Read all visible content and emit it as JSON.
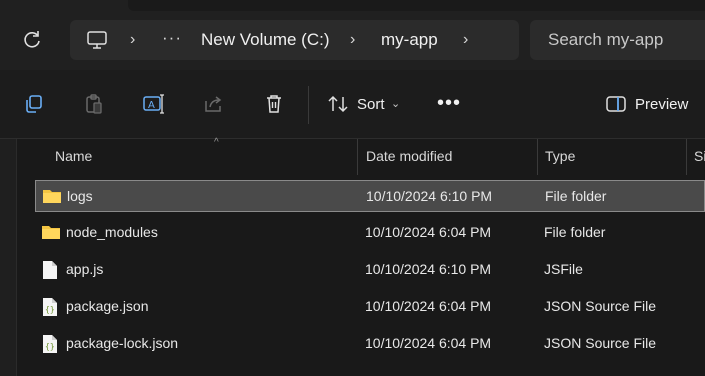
{
  "breadcrumbs": [
    "New Volume (C:)",
    "my-app"
  ],
  "search": {
    "placeholder": "Search my-app"
  },
  "toolbar": {
    "sort_label": "Sort",
    "preview_label": "Preview"
  },
  "columns": [
    "Name",
    "Date modified",
    "Type",
    "Si"
  ],
  "files": [
    {
      "name": "logs",
      "date": "10/10/2024 6:10 PM",
      "type": "File folder",
      "icon": "folder-icon"
    },
    {
      "name": "node_modules",
      "date": "10/10/2024 6:04 PM",
      "type": "File folder",
      "icon": "folder-icon"
    },
    {
      "name": "app.js",
      "date": "10/10/2024 6:10 PM",
      "type": "JSFile",
      "icon": "file-icon"
    },
    {
      "name": "package.json",
      "date": "10/10/2024 6:04 PM",
      "type": "JSON Source File",
      "icon": "json-file-icon"
    },
    {
      "name": "package-lock.json",
      "date": "10/10/2024 6:04 PM",
      "type": "JSON Source File",
      "icon": "json-file-icon"
    }
  ],
  "colors": {
    "folder": "#f4c542",
    "accent": "#5aa0f0"
  }
}
